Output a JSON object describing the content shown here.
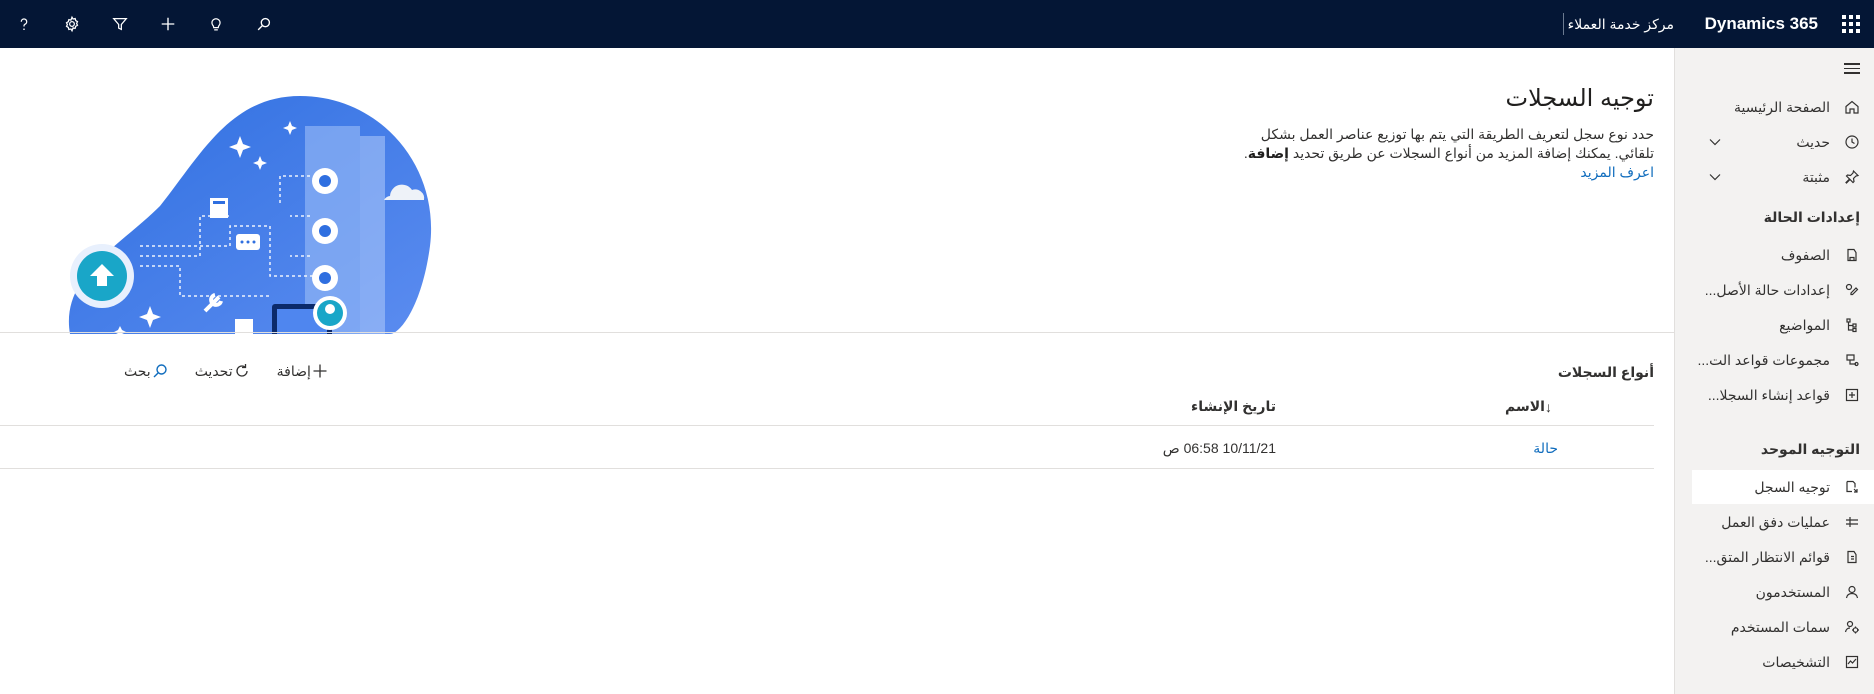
{
  "topbar": {
    "brand": "Dynamics 365",
    "app_name": "مركز خدمة العملاء",
    "icons": [
      "search-icon",
      "lightbulb-icon",
      "plus-icon",
      "filter-icon",
      "gear-icon",
      "help-icon"
    ],
    "background": "#041635"
  },
  "sidebar": {
    "items": [
      {
        "label": "الصفحة الرئيسية",
        "icon": "home-icon"
      },
      {
        "label": "حديث",
        "icon": "clock-icon"
      },
      {
        "label": "مثبتة",
        "icon": "pin-icon"
      }
    ],
    "groups": [
      {
        "title": "إعدادات الحالة",
        "items": [
          {
            "label": "الصفوف",
            "icon": "queue-icon"
          },
          {
            "label": "إعدادات حالة الأصل...",
            "icon": "settings-pen-icon"
          },
          {
            "label": "المواضيع",
            "icon": "tree-icon"
          },
          {
            "label": "مجموعات قواعد الت...",
            "icon": "rules-icon"
          },
          {
            "label": "قواعد إنشاء السجلا...",
            "icon": "record-rules-icon"
          }
        ]
      },
      {
        "title": "التوجيه الموحد",
        "items": [
          {
            "label": "توجيه السجل",
            "icon": "record-routing-icon",
            "selected": true
          },
          {
            "label": "عمليات دفق العمل",
            "icon": "workstream-icon"
          },
          {
            "label": "قوائم الانتظار المتق...",
            "icon": "advanced-queue-icon"
          },
          {
            "label": "المستخدمون",
            "icon": "person-icon"
          },
          {
            "label": "سمات المستخدم",
            "icon": "people-attributes-icon"
          },
          {
            "label": "التشخيصات",
            "icon": "diagnostics-icon"
          }
        ]
      }
    ],
    "accent": "#0f6cbd"
  },
  "hero": {
    "title": "توجيه السجلات",
    "desc_1": "حدد نوع سجل لتعريف الطريقة التي يتم بها توزيع عناصر العمل بشكل تلقائي. يمكنك إضافة المزيد من أنواع السجلات عن طريق تحديد ",
    "desc_bold": "إضافة",
    "desc_2": ". ",
    "learn_more": "اعرف المزيد"
  },
  "records": {
    "section_label": "أنواع السجلات",
    "commands": {
      "add": "إضافة",
      "refresh": "تحديث",
      "search": "بحث"
    },
    "columns": {
      "name": "الاسم",
      "sort_indicator": "↓",
      "created_on": "تاريخ الإنشاء"
    },
    "rows": [
      {
        "name": "حالة",
        "created_on": "10/11/21 06:58 ص"
      }
    ]
  }
}
